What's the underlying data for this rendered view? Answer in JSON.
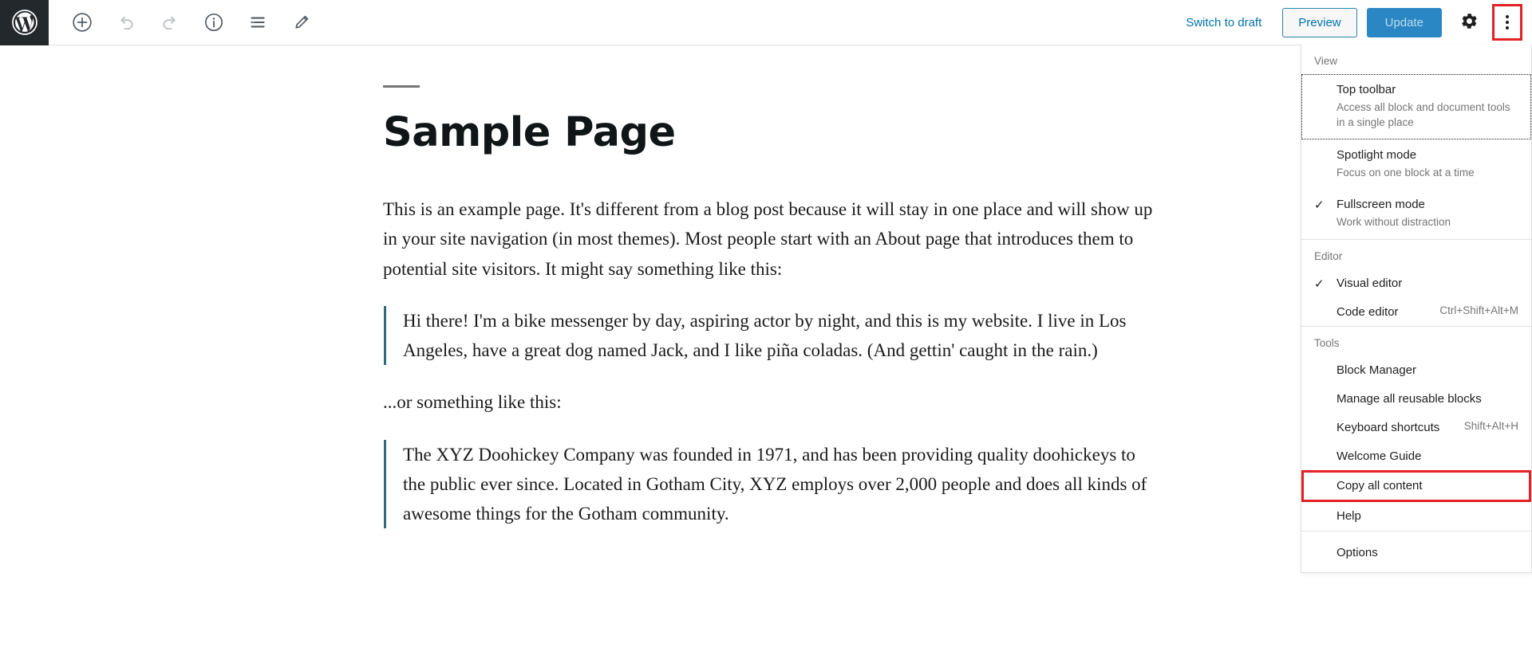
{
  "topbar": {
    "logo_icon": "wordpress-logo-icon",
    "tools": [
      {
        "name": "add-block-button",
        "icon": "plus-circle-icon",
        "disabled": false
      },
      {
        "name": "undo-button",
        "icon": "undo-arrow-icon",
        "disabled": true
      },
      {
        "name": "redo-button",
        "icon": "redo-arrow-icon",
        "disabled": true
      },
      {
        "name": "details-button",
        "icon": "info-circle-icon",
        "disabled": false
      },
      {
        "name": "list-view-button",
        "icon": "list-view-icon",
        "disabled": false
      },
      {
        "name": "edit-button",
        "icon": "pencil-icon",
        "disabled": false
      }
    ],
    "switch_to_draft_label": "Switch to draft",
    "preview_label": "Preview",
    "update_label": "Update",
    "settings_icon": "gear-icon",
    "more_menu_icon": "kebab-vertical-icon",
    "accent_blue": "#0073aa",
    "update_blue": "#2b87c4",
    "highlight_red": "#e32124"
  },
  "post": {
    "title": "Sample Page",
    "paragraph_1": "This is an example page. It's different from a blog post because it will stay in one place and will show up in your site navigation (in most themes). Most people start with an About page that introduces them to potential site visitors. It might say something like this:",
    "quote_1": "Hi there! I'm a bike messenger by day, aspiring actor by night, and this is my website. I live in Los Angeles, have a great dog named Jack, and I like piña coladas. (And gettin' caught in the rain.)",
    "paragraph_2": "...or something like this:",
    "quote_2": "The XYZ Doohickey Company was founded in 1971, and has been providing quality doohickeys to the public ever since. Located in Gotham City, XYZ employs over 2,000 people and does all kinds of awesome things for the Gotham community."
  },
  "menu": {
    "groups": [
      {
        "label": "View",
        "items": [
          {
            "title": "Top toolbar",
            "desc": "Access all block and document tools in a single place",
            "checked": false,
            "focused": true,
            "shortcut": ""
          },
          {
            "title": "Spotlight mode",
            "desc": "Focus on one block at a time",
            "checked": false,
            "focused": false,
            "shortcut": ""
          },
          {
            "title": "Fullscreen mode",
            "desc": "Work without distraction",
            "checked": true,
            "focused": false,
            "shortcut": ""
          }
        ]
      },
      {
        "label": "Editor",
        "items": [
          {
            "title": "Visual editor",
            "desc": "",
            "checked": true,
            "focused": false,
            "shortcut": ""
          },
          {
            "title": "Code editor",
            "desc": "",
            "checked": false,
            "focused": false,
            "shortcut": "Ctrl+Shift+Alt+M"
          }
        ]
      },
      {
        "label": "Tools",
        "items": [
          {
            "title": "Block Manager",
            "desc": "",
            "checked": false,
            "focused": false,
            "shortcut": ""
          },
          {
            "title": "Manage all reusable blocks",
            "desc": "",
            "checked": false,
            "focused": false,
            "shortcut": ""
          },
          {
            "title": "Keyboard shortcuts",
            "desc": "",
            "checked": false,
            "focused": false,
            "shortcut": "Shift+Alt+H"
          },
          {
            "title": "Welcome Guide",
            "desc": "",
            "checked": false,
            "focused": false,
            "shortcut": ""
          },
          {
            "title": "Copy all content",
            "desc": "",
            "checked": false,
            "focused": false,
            "shortcut": "",
            "highlighted": true
          },
          {
            "title": "Help",
            "desc": "",
            "checked": false,
            "focused": false,
            "shortcut": ""
          }
        ]
      },
      {
        "label": "",
        "items": [
          {
            "title": "Options",
            "desc": "",
            "checked": false,
            "focused": false,
            "shortcut": ""
          }
        ]
      }
    ],
    "check_glyph": "✓"
  }
}
